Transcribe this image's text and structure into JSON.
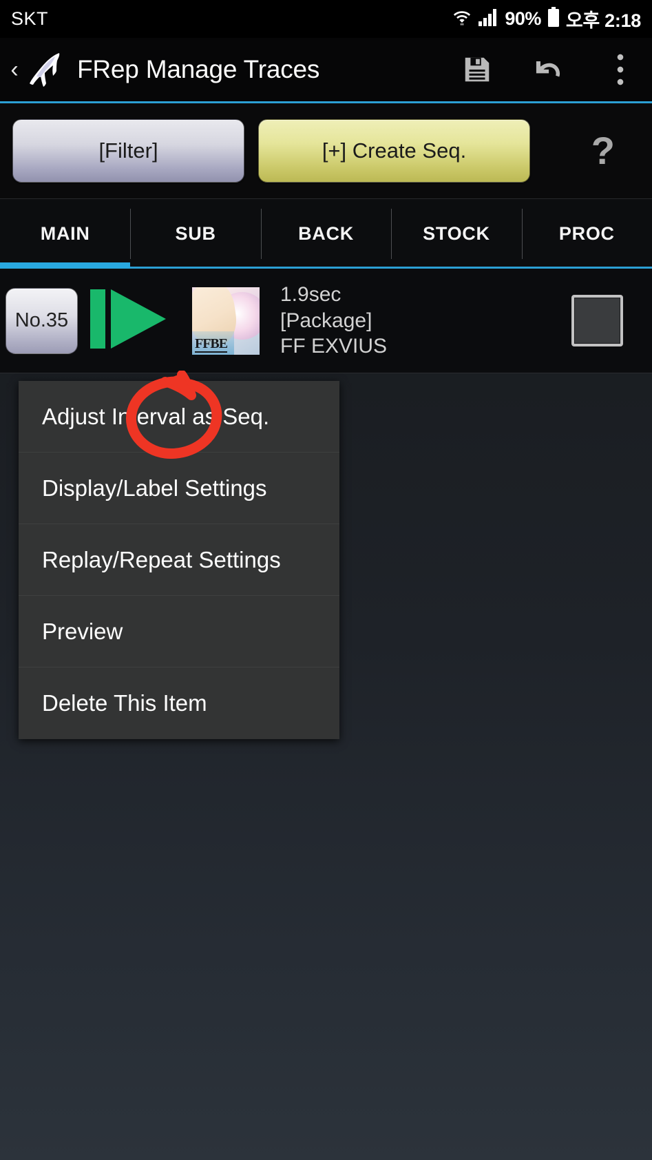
{
  "status_bar": {
    "carrier": "SKT",
    "battery_percent": "90%",
    "clock": "오후 2:18",
    "icons": [
      "wifi-icon",
      "signal-bars-icon",
      "battery-icon"
    ]
  },
  "app_bar": {
    "back_label": "‹",
    "title": "FRep Manage Traces",
    "actions": [
      {
        "name": "save-icon",
        "label": "save"
      },
      {
        "name": "undo-icon",
        "label": "undo"
      },
      {
        "name": "overflow-menu-icon",
        "label": "more options"
      }
    ]
  },
  "toolbar": {
    "filter_label": "[Filter]",
    "create_seq_label": "[+] Create Seq.",
    "help_label": "?"
  },
  "tabs": {
    "items": [
      {
        "label": "MAIN",
        "active": true
      },
      {
        "label": "SUB",
        "active": false
      },
      {
        "label": "BACK",
        "active": false
      },
      {
        "label": "STOCK",
        "active": false
      },
      {
        "label": "PROC",
        "active": false
      }
    ]
  },
  "list": {
    "rows": [
      {
        "number_badge": "No.35",
        "play_icon": "play-from-start-icon",
        "thumbnail_label": "FFBE",
        "duration": "1.9sec",
        "type": "[Package]",
        "app_name": "FF EXVIUS",
        "checked": false
      }
    ]
  },
  "context_menu": {
    "items": [
      {
        "label": "Adjust Interval as Seq."
      },
      {
        "label": "Display/Label Settings"
      },
      {
        "label": "Replay/Repeat Settings"
      },
      {
        "label": "Preview"
      },
      {
        "label": "Delete This Item"
      }
    ]
  },
  "annotation": {
    "shape": "hand-drawn-circle-with-arrow",
    "color": "#ee3524",
    "targets": "Adjust Interval as Seq."
  },
  "colors": {
    "accent_blue": "#2b9fd4",
    "create_yellow": "#d9d76a",
    "play_green": "#19b86b",
    "annotation_red": "#ee3524",
    "menu_bg": "#333434"
  }
}
